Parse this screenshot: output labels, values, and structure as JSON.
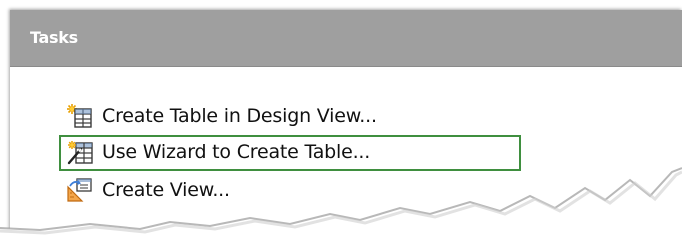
{
  "panel": {
    "title": "Tasks"
  },
  "tasks": [
    {
      "label": "Create Table in Design View...",
      "icon": "table-design-icon"
    },
    {
      "label": "Use Wizard to Create Table...",
      "icon": "table-wizard-icon"
    },
    {
      "label": "Create View...",
      "icon": "create-view-icon"
    }
  ],
  "colors": {
    "header_bg": "#9f9f9f",
    "highlight": "#3f8f3f",
    "text": "#111111"
  }
}
